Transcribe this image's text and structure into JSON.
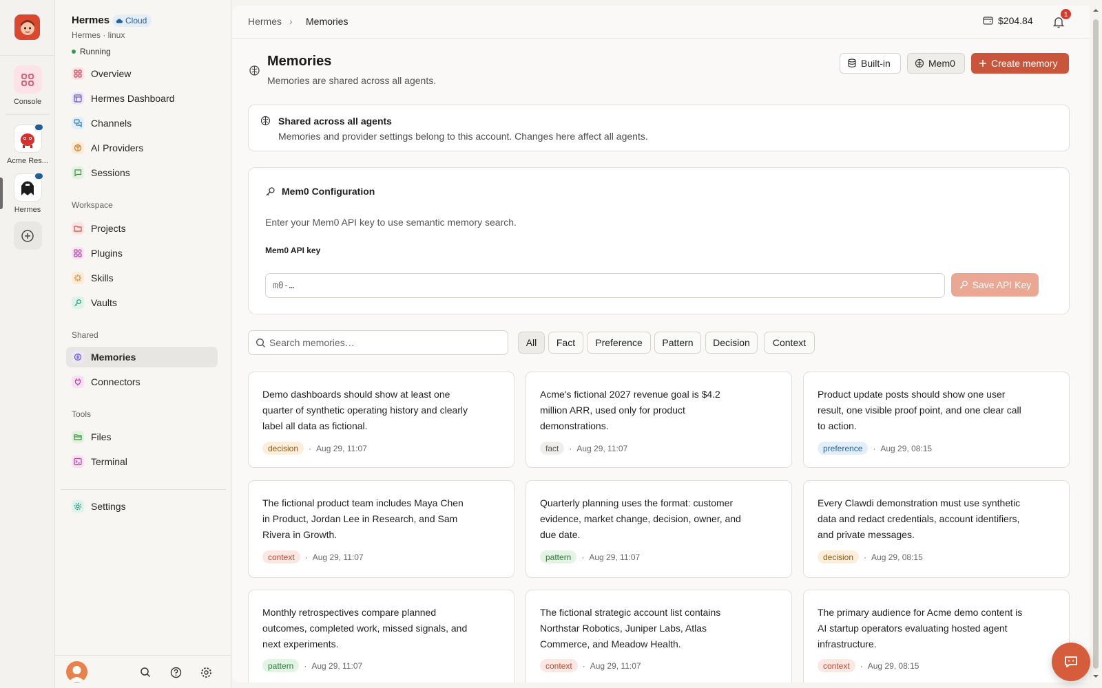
{
  "rail": {
    "console_label": "Console",
    "agents": [
      {
        "label": "Acme Res..."
      },
      {
        "label": "Hermes"
      }
    ]
  },
  "sidebar": {
    "agent_name": "Hermes",
    "cloud_badge": "Cloud",
    "agent_sub": "Hermes · linux",
    "status": "Running",
    "main_items": [
      {
        "label": "Overview",
        "icon": "grid-icon"
      },
      {
        "label": "Hermes Dashboard",
        "icon": "dashboard-icon"
      },
      {
        "label": "Channels",
        "icon": "chat-bubbles-icon"
      },
      {
        "label": "AI Providers",
        "icon": "brain-icon"
      },
      {
        "label": "Sessions",
        "icon": "message-icon"
      }
    ],
    "workspace_label": "Workspace",
    "workspace_items": [
      {
        "label": "Projects",
        "icon": "folder-icon"
      },
      {
        "label": "Plugins",
        "icon": "puzzle-icon"
      },
      {
        "label": "Skills",
        "icon": "sparkle-icon"
      },
      {
        "label": "Vaults",
        "icon": "key-icon"
      }
    ],
    "shared_label": "Shared",
    "shared_items": [
      {
        "label": "Memories",
        "icon": "memory-icon"
      },
      {
        "label": "Connectors",
        "icon": "plug-icon"
      }
    ],
    "tools_label": "Tools",
    "tools_items": [
      {
        "label": "Files",
        "icon": "folder-open-icon"
      },
      {
        "label": "Terminal",
        "icon": "terminal-icon"
      }
    ],
    "settings_label": "Settings"
  },
  "topbar": {
    "crumbs": [
      "Hermes",
      "Memories"
    ],
    "balance": "$204.84",
    "notifications": "1"
  },
  "page": {
    "title": "Memories",
    "subtitle": "Memories are shared across all agents.",
    "buttons": {
      "builtin": "Built-in",
      "mem0": "Mem0",
      "create": "Create memory"
    }
  },
  "info": {
    "title": "Shared across all agents",
    "text": "Memories and provider settings belong to this account. Changes here affect all agents."
  },
  "config": {
    "title": "Mem0 Configuration",
    "description": "Enter your Mem0 API key to use semantic memory search.",
    "label": "Mem0 API key",
    "placeholder": "m0-…",
    "save_label": "Save API Key"
  },
  "search": {
    "placeholder": "Search memories…"
  },
  "filters": [
    "All",
    "Fact",
    "Preference",
    "Pattern",
    "Decision",
    "Context"
  ],
  "memories": [
    {
      "text": "Demo dashboards should show at least one quarter of synthetic operating history and clearly label all data as fictional.",
      "tag": "decision",
      "time": "Aug 29, 11:07"
    },
    {
      "text": "Acme's fictional 2027 revenue goal is $4.2 million ARR, used only for product demonstrations.",
      "tag": "fact",
      "time": "Aug 29, 11:07"
    },
    {
      "text": "Product update posts should show one user result, one visible proof point, and one clear call to action.",
      "tag": "preference",
      "time": "Aug 29, 08:15"
    },
    {
      "text": "The fictional product team includes Maya Chen in Product, Jordan Lee in Research, and Sam Rivera in Growth.",
      "tag": "context",
      "time": "Aug 29, 11:07"
    },
    {
      "text": "Quarterly planning uses the format: customer evidence, market change, decision, owner, and due date.",
      "tag": "pattern",
      "time": "Aug 29, 11:07"
    },
    {
      "text": "Every Clawdi demonstration must use synthetic data and redact credentials, account identifiers, and private messages.",
      "tag": "decision",
      "time": "Aug 29, 08:15"
    },
    {
      "text": "Monthly retrospectives compare planned outcomes, completed work, missed signals, and next experiments.",
      "tag": "pattern",
      "time": "Aug 29, 11:07"
    },
    {
      "text": "The fictional strategic account list contains Northstar Robotics, Juniper Labs, Atlas Commerce, and Meadow Health.",
      "tag": "context",
      "time": "Aug 29, 11:07"
    },
    {
      "text": "The primary audience for Acme demo content is AI startup operators evaluating hosted agent infrastructure.",
      "tag": "context",
      "time": "Aug 29, 08:15"
    }
  ],
  "colors": {
    "accent": "#c9563a",
    "running": "#2f9d4b",
    "cloud": "#1f5e99"
  }
}
